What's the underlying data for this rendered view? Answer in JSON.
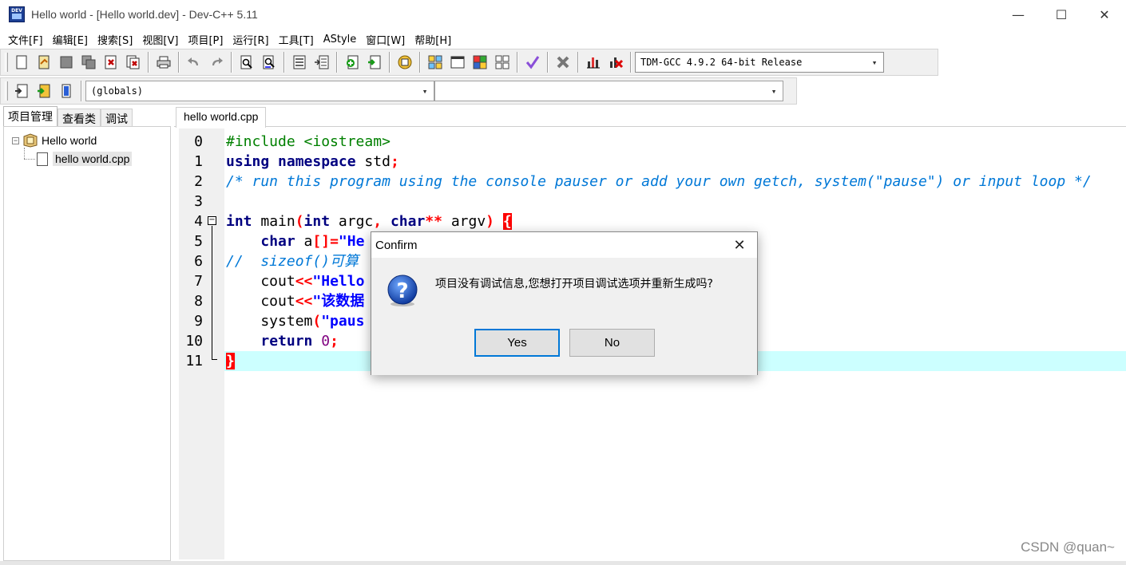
{
  "window": {
    "title": "Hello world - [Hello world.dev] - Dev-C++ 5.11",
    "app_icon_text": "DEV",
    "minimize": "—",
    "maximize": "☐",
    "close": "✕"
  },
  "menu": [
    "文件[F]",
    "编辑[E]",
    "搜索[S]",
    "视图[V]",
    "项目[P]",
    "运行[R]",
    "工具[T]",
    "AStyle",
    "窗口[W]",
    "帮助[H]"
  ],
  "toolbar": {
    "compiler": "TDM-GCC 4.9.2 64-bit Release",
    "scope": "(globals)",
    "symbol": ""
  },
  "left_panel": {
    "tabs": [
      "项目管理",
      "查看类",
      "调试"
    ],
    "tree": {
      "project": "Hello world",
      "file": "hello world.cpp",
      "expander": "−"
    }
  },
  "editor": {
    "tab": "hello world.cpp",
    "line_numbers": [
      "0",
      "1",
      "2",
      "3",
      "4",
      "5",
      "6",
      "7",
      "8",
      "9",
      "10",
      "11"
    ],
    "fold_sign": "−"
  },
  "dialog": {
    "title": "Confirm",
    "close": "✕",
    "message": "项目没有调试信息,您想打开项目调试选项并重新生成吗?",
    "yes": "Yes",
    "no": "No"
  },
  "watermark": "CSDN @quan~",
  "colors": {
    "keyword": "#000080",
    "comment": "#0078d7",
    "string": "#0000ff",
    "symbol": "#ff0000",
    "current_line": "#ccffff",
    "dialog_default_border": "#0078d7"
  }
}
